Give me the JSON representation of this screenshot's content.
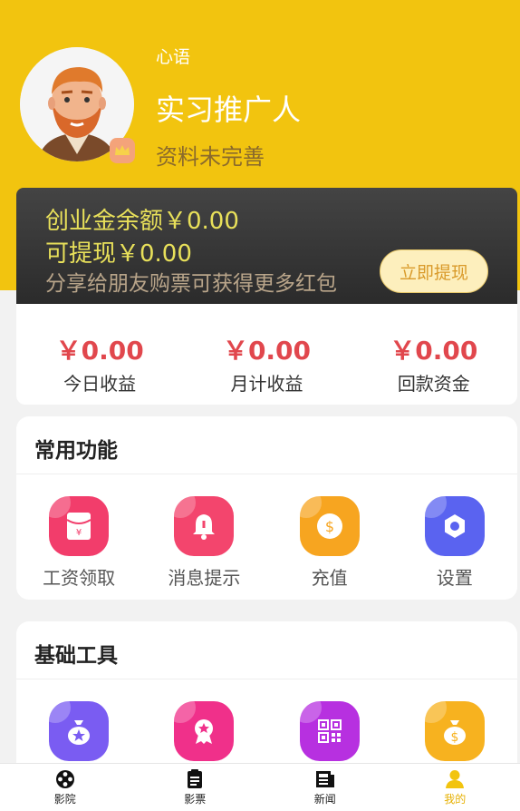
{
  "profile": {
    "nickname": "心语",
    "role": "实习推广人",
    "status": "资料未完善"
  },
  "balance": {
    "startup_fund": "创业金余额￥0.00",
    "withdrawable": "可提现￥0.00",
    "share_tip": "分享给朋友购票可获得更多红包",
    "withdraw_button": "立即提现"
  },
  "stats": [
    {
      "value": "￥0.00",
      "label": "今日收益"
    },
    {
      "value": "￥0.00",
      "label": "月计收益"
    },
    {
      "value": "￥0.00",
      "label": "回款资金"
    }
  ],
  "common_functions": {
    "title": "常用功能",
    "items": [
      {
        "label": "工资领取",
        "icon": "red-envelope-icon",
        "color": "#f23d6b"
      },
      {
        "label": "消息提示",
        "icon": "bell-icon",
        "color": "#f3456d"
      },
      {
        "label": "充值",
        "icon": "coin-icon",
        "color": "#f7a520"
      },
      {
        "label": "设置",
        "icon": "gear-icon",
        "color": "#5a63f0"
      }
    ]
  },
  "basic_tools": {
    "title": "基础工具",
    "items": [
      {
        "label": "",
        "icon": "money-bag-icon",
        "color": "#7a5cf2"
      },
      {
        "label": "",
        "icon": "award-icon",
        "color": "#f0308a"
      },
      {
        "label": "",
        "icon": "qr-code-icon",
        "color": "#b730e0"
      },
      {
        "label": "",
        "icon": "dollar-bag-icon",
        "color": "#f7b21f"
      }
    ]
  },
  "tabbar": [
    {
      "label": "影院",
      "icon": "film-reel-icon",
      "active": false
    },
    {
      "label": "影票",
      "icon": "ticket-icon",
      "active": false
    },
    {
      "label": "新闻",
      "icon": "newspaper-icon",
      "active": false
    },
    {
      "label": "我的",
      "icon": "user-icon",
      "active": true
    }
  ],
  "colors": {
    "brand_yellow": "#f2c40f",
    "stat_red": "#e1474d",
    "active_tab": "#e6b000"
  }
}
